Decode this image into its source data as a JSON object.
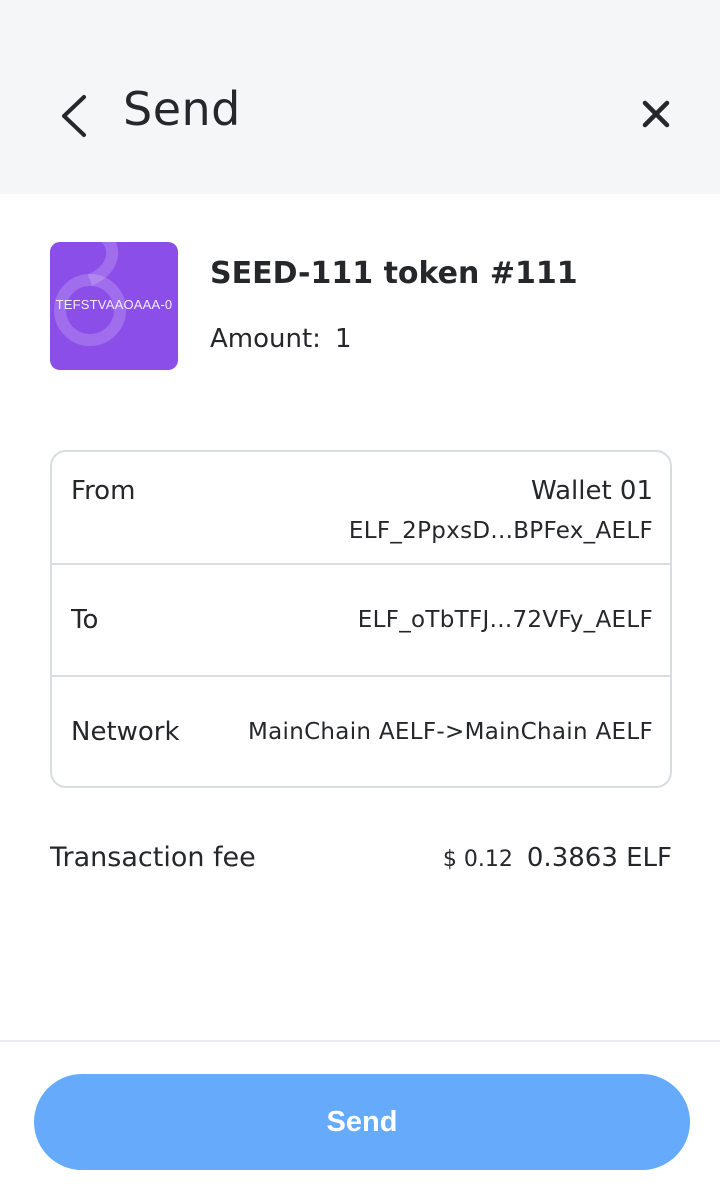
{
  "header": {
    "title": "Send",
    "back_icon": "chevron-left-icon",
    "close_icon": "close-icon"
  },
  "token": {
    "image_text": "TEFSTVAAOAAA-0",
    "image_color": "#8b4ee8",
    "name": "SEED-111 token #111",
    "amount_label": "Amount:",
    "amount_value": "1"
  },
  "details": {
    "from_label": "From",
    "from_wallet": "Wallet 01",
    "from_address": "ELF_2PpxsD...BPFex_AELF",
    "to_label": "To",
    "to_address": "ELF_oTbTFJ...72VFy_AELF",
    "network_label": "Network",
    "network_value": "MainChain AELF->MainChain AELF"
  },
  "fee": {
    "label": "Transaction fee",
    "usd": "$ 0.12",
    "elf": "0.3863 ELF"
  },
  "send_button": {
    "label": "Send",
    "color": "#66abfb"
  }
}
